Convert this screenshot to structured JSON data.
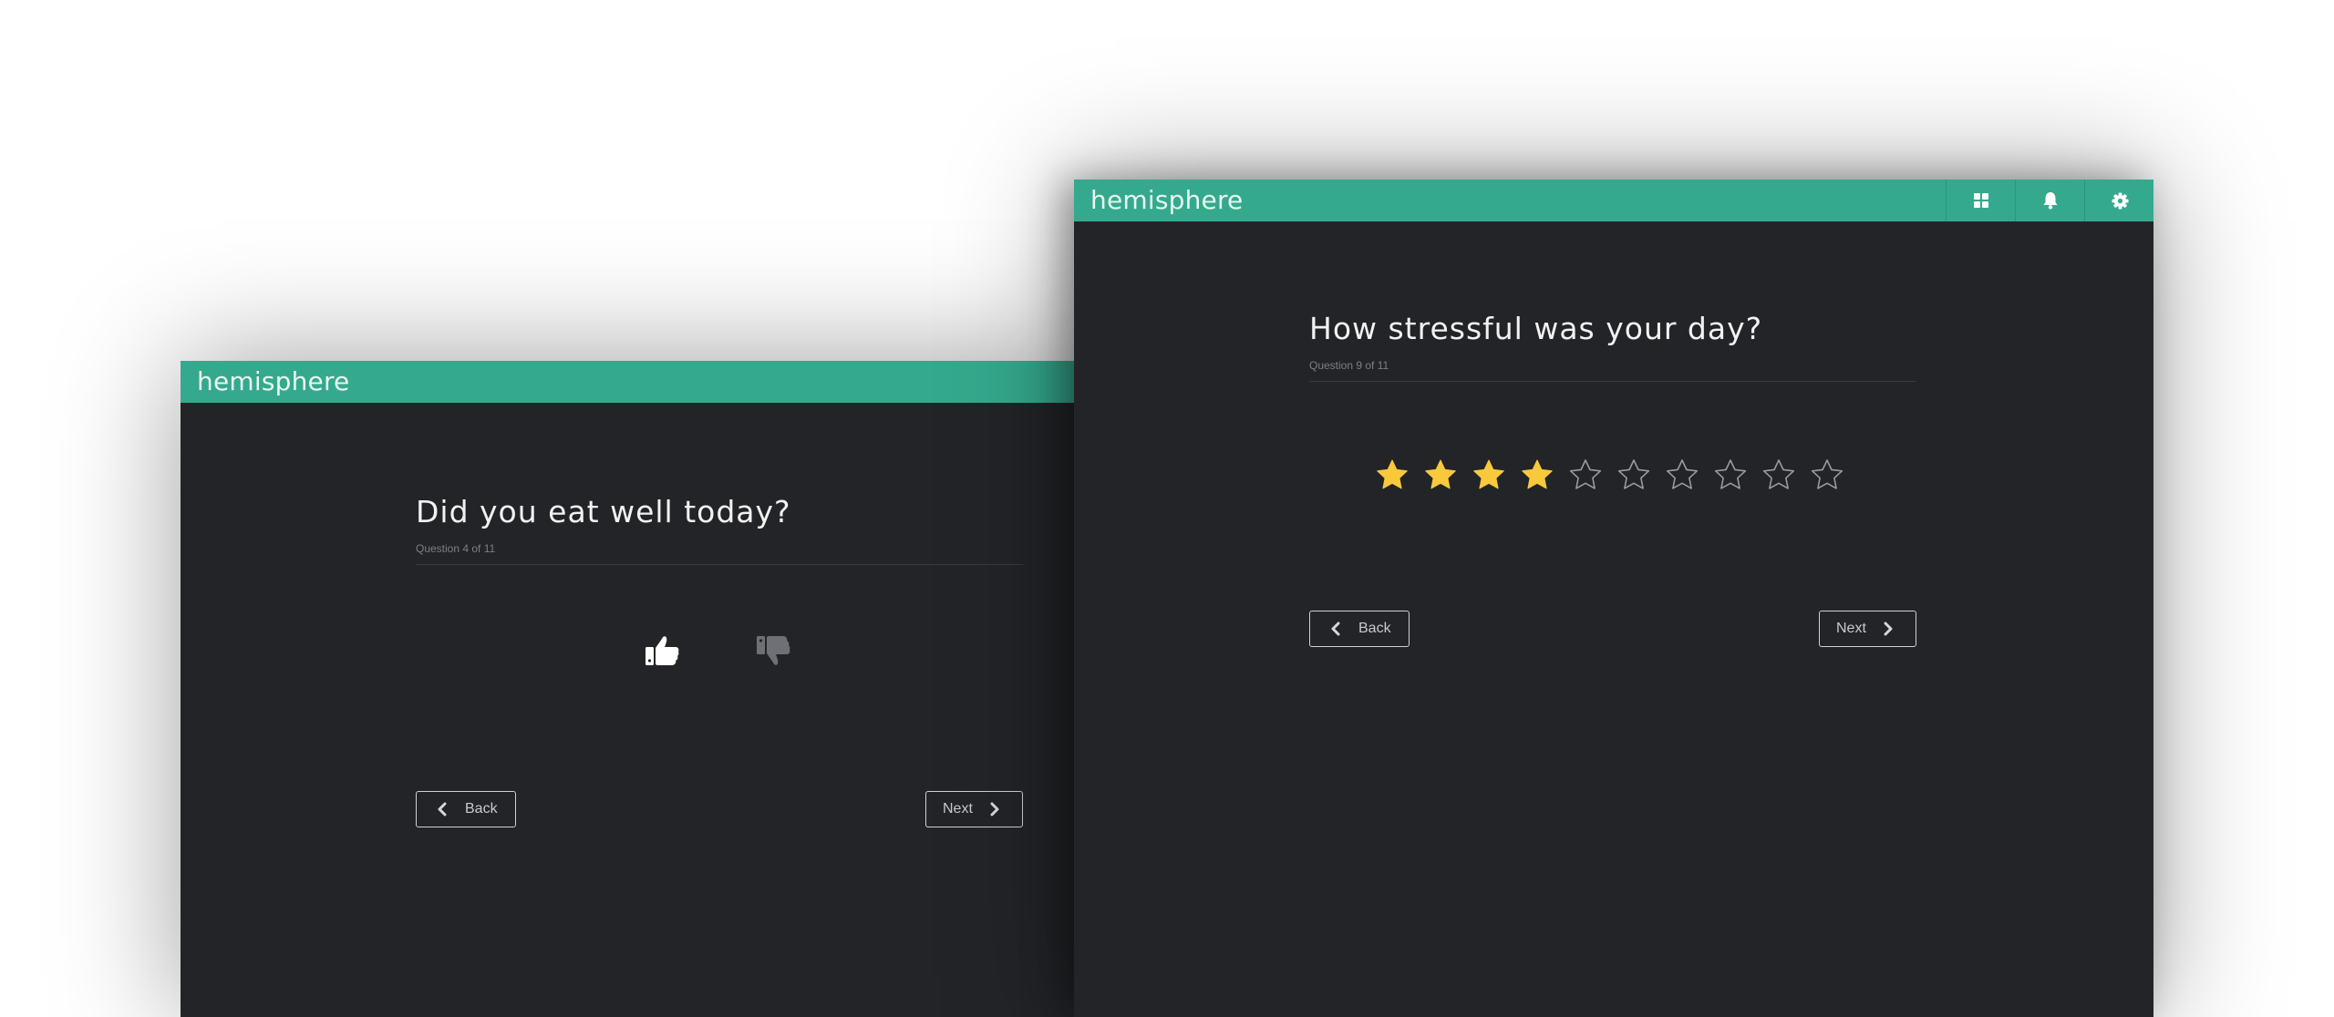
{
  "app": {
    "brand": "hemisphere"
  },
  "colors": {
    "accent": "#35a98d",
    "background": "#232428",
    "star_filled": "#f9c93c",
    "star_empty": "#9a9ba0"
  },
  "left_window": {
    "question": "Did you eat well today?",
    "progress": "Question 4 of 11",
    "answer_options": [
      {
        "icon": "thumbs-up-icon",
        "state": "selected"
      },
      {
        "icon": "thumbs-down-icon",
        "state": "unselected"
      }
    ],
    "back_label": "Back",
    "next_label": "Next"
  },
  "right_window": {
    "question": "How stressful was your day?",
    "progress": "Question 9 of 11",
    "rating": {
      "value": 4,
      "max": 10
    },
    "topbar_icons": [
      "grid-icon",
      "bell-icon",
      "gear-icon"
    ],
    "back_label": "Back",
    "next_label": "Next"
  }
}
